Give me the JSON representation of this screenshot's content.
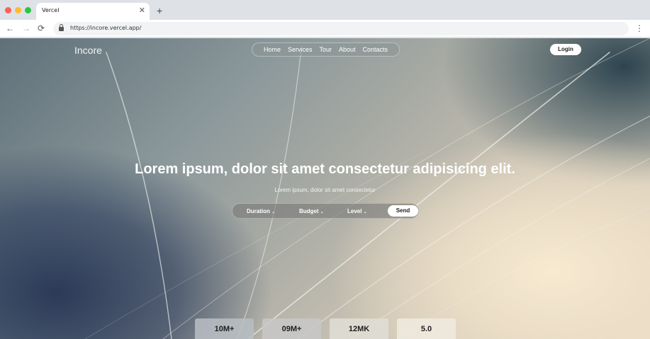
{
  "browser": {
    "tab_title": "Vercel",
    "tab_close": "✕",
    "new_tab": "+",
    "url": "https://incore.vercel.app/",
    "back": "←",
    "forward": "→",
    "reload": "⟳",
    "menu": "⋮"
  },
  "site": {
    "brand": "Incore",
    "nav": [
      "Home",
      "Services",
      "Tour",
      "About",
      "Contacts"
    ],
    "login": "Login"
  },
  "hero": {
    "title": "Lorem ipsum, dolor sit amet consectetur adipisicing elit.",
    "subtitle": "Lorem ipsum, dolor sit amet consectetur"
  },
  "filter": {
    "duration": "Duration",
    "budget": "Budget",
    "level": "Level",
    "send": "Send",
    "chevron": "⌄"
  },
  "stats": [
    "10M+",
    "09M+",
    "12MK",
    "5.0"
  ]
}
